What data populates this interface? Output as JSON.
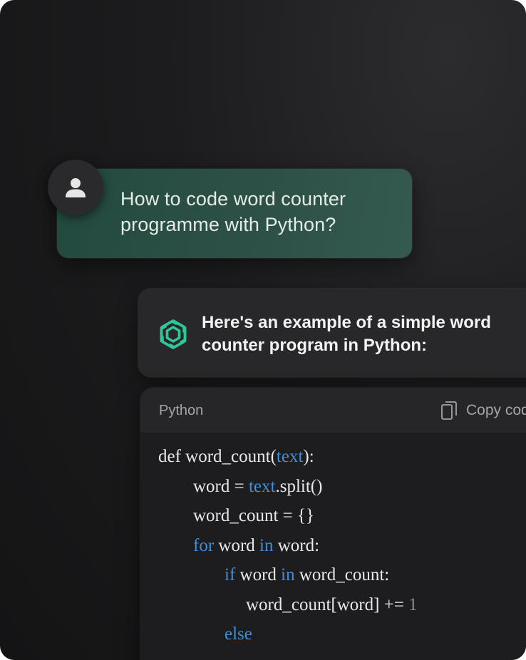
{
  "user_message": {
    "text": "How to code word counter programme with Python?",
    "avatar_icon": "user-silhouette-icon"
  },
  "assistant_message": {
    "text": "Here's an example of a simple word counter program in Python:",
    "logo_icon": "assistant-logo-icon",
    "accent_color": "#2fc79a"
  },
  "code_block": {
    "language": "Python",
    "copy_label": "Copy code",
    "keyword_color": "#3d8fd9",
    "lines": [
      {
        "indent": 0,
        "tokens": [
          {
            "text": "def word_count(",
            "type": "plain"
          },
          {
            "text": "text",
            "type": "kw"
          },
          {
            "text": "):",
            "type": "plain"
          }
        ]
      },
      {
        "indent": 1,
        "tokens": [
          {
            "text": "word = ",
            "type": "plain"
          },
          {
            "text": "text",
            "type": "kw"
          },
          {
            "text": ".split()",
            "type": "plain"
          }
        ]
      },
      {
        "indent": 1,
        "tokens": [
          {
            "text": "word_count = {}",
            "type": "plain"
          }
        ]
      },
      {
        "indent": 1,
        "tokens": [
          {
            "text": "for",
            "type": "kw"
          },
          {
            "text": " word ",
            "type": "plain"
          },
          {
            "text": "in",
            "type": "kw"
          },
          {
            "text": " word:",
            "type": "plain"
          }
        ]
      },
      {
        "indent": 2,
        "tokens": [
          {
            "text": "if",
            "type": "kw"
          },
          {
            "text": " word ",
            "type": "plain"
          },
          {
            "text": "in",
            "type": "kw"
          },
          {
            "text": " word_count:",
            "type": "plain"
          }
        ]
      },
      {
        "indent": 3,
        "tokens": [
          {
            "text": "word_count[word] += ",
            "type": "plain"
          },
          {
            "text": "1",
            "type": "num"
          }
        ]
      },
      {
        "indent": 2,
        "tokens": [
          {
            "text": "else",
            "type": "kw"
          }
        ]
      }
    ]
  }
}
